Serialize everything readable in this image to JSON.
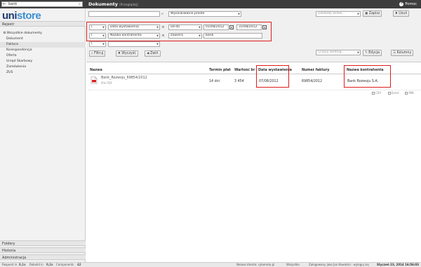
{
  "topbar": {
    "search_value": "bank",
    "title": "Dokumenty",
    "subtitle": "(Przeglądaj)",
    "help_label": "Pomoc"
  },
  "sidebar": {
    "logo_a": "uni",
    "logo_b": "store",
    "section_registers": "Rejestr",
    "items": [
      {
        "label": "Wszystkie dokumenty",
        "active": false
      },
      {
        "label": "Dokument",
        "active": false
      },
      {
        "label": "Faktura",
        "active": true
      },
      {
        "label": "Korespondencja",
        "active": false
      },
      {
        "label": "Oferta",
        "active": false
      },
      {
        "label": "Urząd Skarbowy",
        "active": false
      },
      {
        "label": "Zamówienia",
        "active": false
      },
      {
        "label": "ZUS",
        "active": false
      }
    ],
    "bottom_sections": [
      "Foldery",
      "Historia",
      "Administracja"
    ]
  },
  "filters": {
    "mode_select": "Wyszukiwanie proste",
    "saved_view_placeholder": "Zakładaj widok...",
    "save_label": "Zapisz",
    "delete_label": "Usuń",
    "rows": [
      {
        "field": "Data wystawienia",
        "operator": "od-do",
        "value1": "01/08/2012",
        "value2": "31/08/2012"
      },
      {
        "field": "Nazwa kontrahenta",
        "operator": "zawiera",
        "value1": "bank"
      }
    ],
    "empty_row_paren": "(",
    "group_placeholder": "Grupuj według...",
    "edit_label": "Edycja",
    "columns_label": "Kolumny",
    "filter_label": "Filtruj",
    "clear_label": "Wyczyść",
    "collapse_label": "Zwiń"
  },
  "table": {
    "headers": [
      "Nazwa",
      "Termin płat",
      "Wartość br",
      "Data wystawienia",
      "Numer faktury",
      "Nazwa kontrahenta"
    ],
    "rows": [
      {
        "name": "Bank_Rozwoju_69854/2012",
        "file_type": "Plik PDF",
        "term": "14 dni",
        "value": "3 454",
        "issue_date": "07/08/2012",
        "invoice_no": "69854/2012",
        "contractor": "Bank Rozwoju S.A."
      }
    ],
    "exports": [
      "CSV",
      "Excel",
      "XML"
    ]
  },
  "statusbar": {
    "request_label": "Request in",
    "request_value": "0,1s",
    "rebuild_label": "Rebuild in",
    "rebuild_value": "0,2s",
    "components_label": "Components",
    "components_value": "42",
    "client": "Nazwa klienta: cyberedu.pl",
    "scope": "Wszystko",
    "user": "Zalogowany jako Jan Kowalski · wyloguj się",
    "datetime": "Styczeń 23, 2014 16:56:03"
  },
  "colors": {
    "topbar": "#3d3d3d",
    "highlight": "#e01b1b",
    "logo_dark": "#1f3c6e",
    "logo_light": "#3b8fd4"
  }
}
